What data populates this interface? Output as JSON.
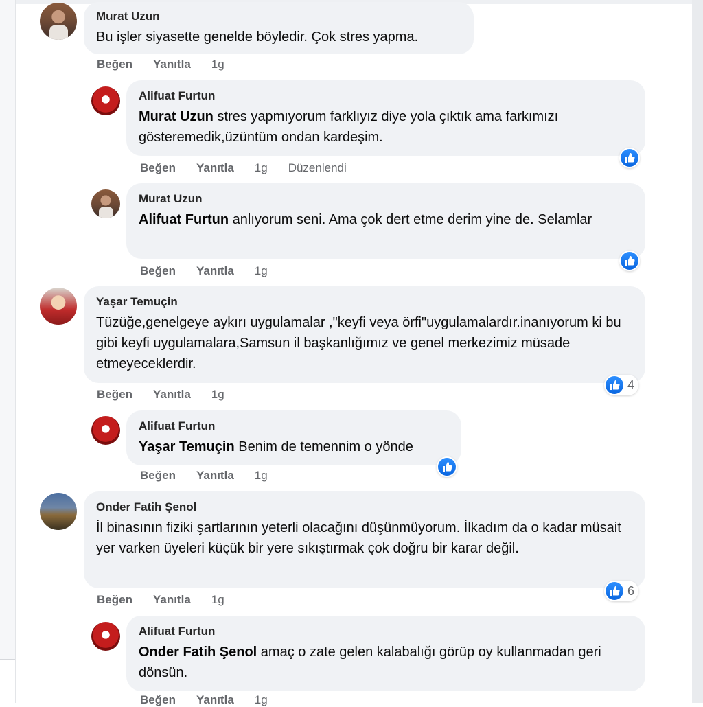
{
  "actions": {
    "like": "Beğen",
    "reply": "Yanıtla",
    "edited": "Düzenlendi"
  },
  "comments": [
    {
      "author": "Murat Uzun",
      "text": "Bu işler siyasette genelde böyledir. Çok stres yapma.",
      "time": "1g"
    },
    {
      "author": "Alifuat Furtun",
      "mention": "Murat Uzun",
      "text": " stres yapmıyorum farklıyız diye yola çıktık ama farkımızı gösteremedik,üzüntüm ondan kardeşim.",
      "time": "1g"
    },
    {
      "author": "Murat Uzun",
      "mention": "Alifuat Furtun",
      "text": " anlıyorum seni. Ama çok dert etme derim yine de. Selamlar",
      "time": "1g"
    },
    {
      "author": "Yaşar Temuçin",
      "text": "Tüzüğe,genelgeye aykırı uygulamalar ,\"keyfi veya örfi\"uygulamalardır.inanıyorum ki bu gibi keyfi uygulamalara,Samsun il başkanlığımız ve genel merkezimiz müsade etmeyeceklerdir.",
      "time": "1g",
      "likes": "4"
    },
    {
      "author": "Alifuat Furtun",
      "mention": "Yaşar Temuçin",
      "text": " Benim de temennim o yönde",
      "time": "1g"
    },
    {
      "author": "Onder Fatih Şenol",
      "text": "İl binasının fiziki şartlarının yeterli olacağını düşünmüyorum. İlkadım da o kadar müsait yer varken üyeleri küçük bir yere sıkıştırmak çok doğru bir karar değil.",
      "time": "1g",
      "likes": "6"
    },
    {
      "author": "Alifuat Furtun",
      "mention": "Onder Fatih Şenol",
      "text": " amaç o zate gelen kalabalığı görüp oy kullanmadan geri dönsün.",
      "time": "1g"
    }
  ],
  "colors": {
    "bubble": "#f0f2f5",
    "like_blue": "#1877f2",
    "meta_gray": "#65676b"
  }
}
